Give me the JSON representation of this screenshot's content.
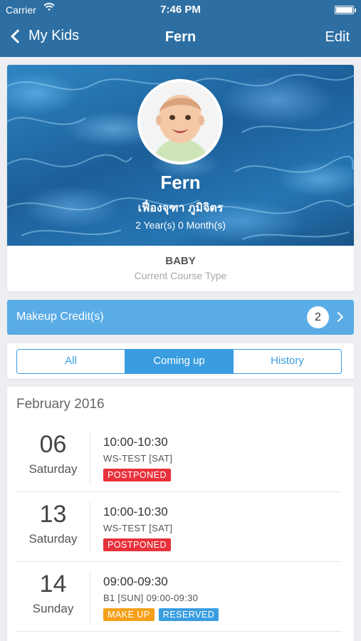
{
  "status_bar": {
    "carrier": "Carrier",
    "time": "7:46 PM"
  },
  "nav": {
    "back_label": "My Kids",
    "title": "Fern",
    "edit_label": "Edit"
  },
  "profile": {
    "name": "Fern",
    "thai_name": "เฟื่องจุฑา ภูมิจิตร",
    "age": "2 Year(s) 0 Month(s)",
    "course_type": "BABY",
    "course_caption": "Current Course Type"
  },
  "makeup": {
    "label": "Makeup Credit(s)",
    "count": "2"
  },
  "tabs": [
    {
      "label": "All",
      "active": false
    },
    {
      "label": "Coming up",
      "active": true
    },
    {
      "label": "History",
      "active": false
    }
  ],
  "schedule": {
    "month": "February 2016",
    "items": [
      {
        "day": "06",
        "weekday": "Saturday",
        "time": "10:00-10:30",
        "class": "WS-TEST [SAT]",
        "badges": [
          {
            "text": "POSTPONED",
            "color": "#e8313b"
          }
        ]
      },
      {
        "day": "13",
        "weekday": "Saturday",
        "time": "10:00-10:30",
        "class": "WS-TEST [SAT]",
        "badges": [
          {
            "text": "POSTPONED",
            "color": "#e8313b"
          }
        ]
      },
      {
        "day": "14",
        "weekday": "Sunday",
        "time": "09:00-09:30",
        "class": "B1 [SUN] 09:00-09:30",
        "badges": [
          {
            "text": "MAKE UP",
            "color": "#f5a01a"
          },
          {
            "text": "RESERVED",
            "color": "#3a9de0"
          }
        ]
      }
    ]
  },
  "colors": {
    "nav": "#2e6fa3",
    "accent": "#3a9de0",
    "makeup_bar": "#5aace6",
    "postponed": "#e8313b",
    "makeup": "#f5a01a",
    "reserved": "#3a9de0"
  }
}
